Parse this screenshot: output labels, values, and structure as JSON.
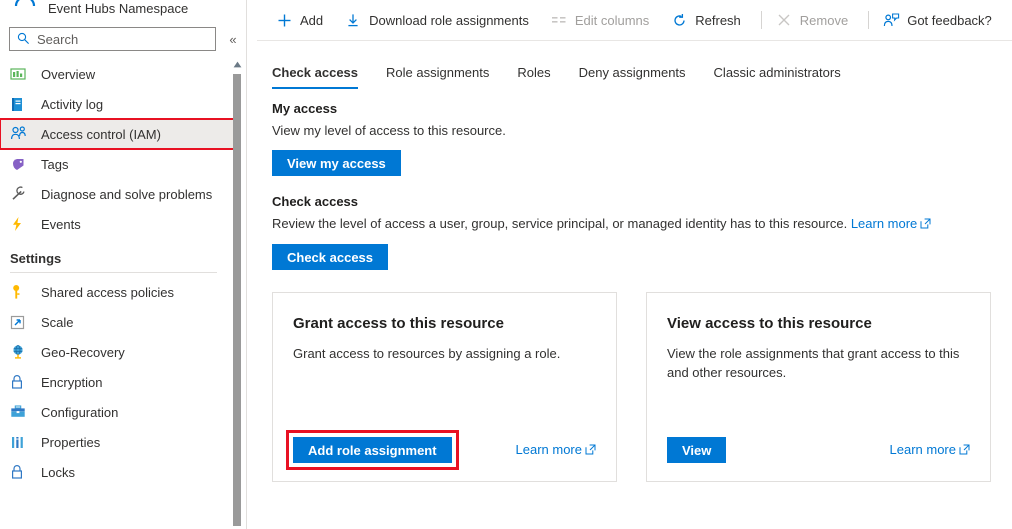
{
  "resource": {
    "icon": "event-hubs-icon",
    "title": "Event Hubs Namespace"
  },
  "search": {
    "placeholder": "Search",
    "value": "",
    "icon": "search-icon",
    "collapse_icon": "chevron-double-left-icon",
    "collapse_label": "«"
  },
  "sidebar": {
    "items": [
      {
        "label": "Overview",
        "icon": "overview-icon"
      },
      {
        "label": "Activity log",
        "icon": "activity-log-icon"
      },
      {
        "label": "Access control (IAM)",
        "icon": "access-control-icon",
        "selected": true,
        "highlighted": true
      },
      {
        "label": "Tags",
        "icon": "tags-icon"
      },
      {
        "label": "Diagnose and solve problems",
        "icon": "wrench-icon"
      },
      {
        "label": "Events",
        "icon": "events-lightning-icon"
      }
    ],
    "settings_section": {
      "title": "Settings",
      "items": [
        {
          "label": "Shared access policies",
          "icon": "key-icon"
        },
        {
          "label": "Scale",
          "icon": "scale-arrow-icon"
        },
        {
          "label": "Geo-Recovery",
          "icon": "globe-icon"
        },
        {
          "label": "Encryption",
          "icon": "lock-icon"
        },
        {
          "label": "Configuration",
          "icon": "configuration-toolbox-icon"
        },
        {
          "label": "Properties",
          "icon": "properties-bars-icon"
        },
        {
          "label": "Locks",
          "icon": "lock-icon"
        }
      ]
    },
    "scrollbar": {
      "up_arrow_icon": "scroll-up-arrow-icon"
    }
  },
  "toolbar": {
    "items": [
      {
        "label": "Add",
        "icon": "plus-icon",
        "disabled": false
      },
      {
        "label": "Download role assignments",
        "icon": "download-icon",
        "disabled": false
      },
      {
        "label": "Edit columns",
        "icon": "edit-columns-icon",
        "disabled": true
      },
      {
        "label": "Refresh",
        "icon": "refresh-icon",
        "disabled": false
      },
      {
        "label": "Remove",
        "icon": "remove-x-icon",
        "disabled": true
      },
      {
        "label": "Got feedback?",
        "icon": "feedback-person-icon",
        "disabled": false
      }
    ]
  },
  "tabs": [
    {
      "label": "Check access",
      "active": true
    },
    {
      "label": "Role assignments",
      "active": false
    },
    {
      "label": "Roles",
      "active": false
    },
    {
      "label": "Deny assignments",
      "active": false
    },
    {
      "label": "Classic administrators",
      "active": false
    }
  ],
  "main": {
    "my_access": {
      "title": "My access",
      "description": "View my level of access to this resource.",
      "button_label": "View my access"
    },
    "check_access": {
      "title": "Check access",
      "description": "Review the level of access a user, group, service principal, or managed identity has to this resource.",
      "learn_more_label": "Learn more",
      "button_label": "Check access"
    },
    "cards": [
      {
        "title": "Grant access to this resource",
        "description": "Grant access to resources by assigning a role.",
        "button_label": "Add role assignment",
        "button_highlighted": true,
        "learn_more_label": "Learn more"
      },
      {
        "title": "View access to this resource",
        "description": "View the role assignments that grant access to this and other resources.",
        "button_label": "View",
        "button_highlighted": false,
        "learn_more_label": "Learn more"
      }
    ]
  },
  "colors": {
    "accent": "#0078d4",
    "highlight_box": "#e81123",
    "selected_row": "#edebe9",
    "text": "#323130",
    "disabled_text": "#a19f9d"
  }
}
